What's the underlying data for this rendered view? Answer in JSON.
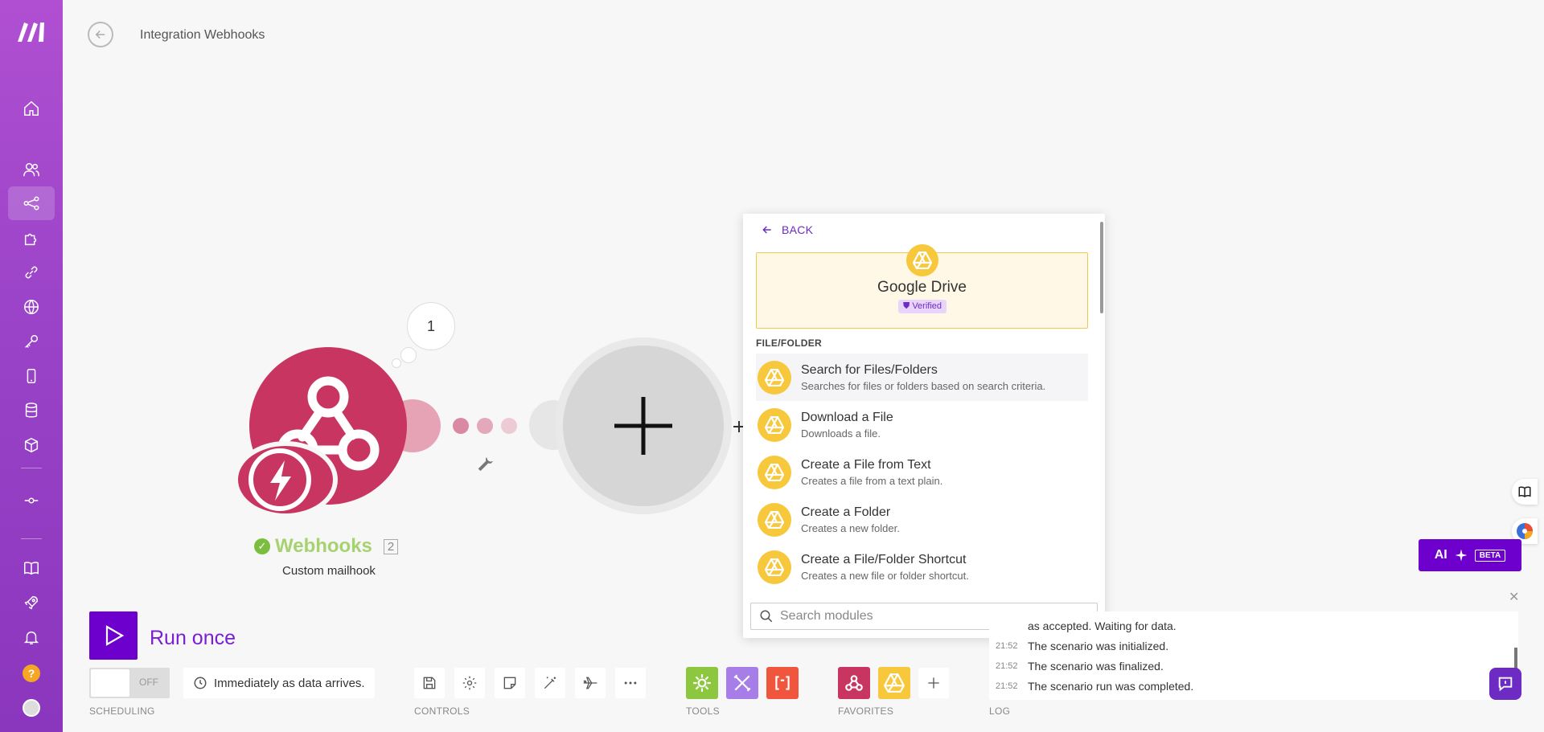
{
  "header": {
    "title": "Integration Webhooks"
  },
  "canvas": {
    "bubble_count": "1",
    "trigger_node": {
      "title": "Webhooks",
      "id": "2",
      "subtitle": "Custom mailhook"
    }
  },
  "picker": {
    "back_label": "BACK",
    "app_name": "Google Drive",
    "verified_label": "Verified",
    "section": "FILE/FOLDER",
    "modules": [
      {
        "name": "Search for Files/Folders",
        "desc": "Searches for files or folders based on search criteria."
      },
      {
        "name": "Download a File",
        "desc": "Downloads a file."
      },
      {
        "name": "Create a File from Text",
        "desc": "Creates a file from a text plain."
      },
      {
        "name": "Create a Folder",
        "desc": "Creates a new folder."
      },
      {
        "name": "Create a File/Folder Shortcut",
        "desc": "Creates a new file or folder shortcut."
      }
    ],
    "search_placeholder": "Search modules"
  },
  "toolbar": {
    "run_label": "Run once",
    "toggle_state": "OFF",
    "schedule_text": "Immediately as data arrives.",
    "labels": {
      "scheduling": "SCHEDULING",
      "controls": "CONTROLS",
      "tools": "TOOLS",
      "favorites": "FAVORITES",
      "log": "LOG"
    }
  },
  "log": {
    "entries": [
      {
        "time": "",
        "text": "as accepted. Waiting for data."
      },
      {
        "time": "21:52",
        "text": "The scenario was initialized."
      },
      {
        "time": "21:52",
        "text": "The scenario was finalized."
      },
      {
        "time": "21:52",
        "text": "The scenario run was completed."
      }
    ]
  },
  "ai": {
    "label": "AI",
    "beta": "BETA"
  },
  "colors": {
    "brand": "#6d00cc",
    "webhook": "#c93561",
    "drive": "#f7c73c",
    "tool_green": "#8dc63f",
    "tool_purple": "#a77de8",
    "tool_red": "#f0553d"
  }
}
